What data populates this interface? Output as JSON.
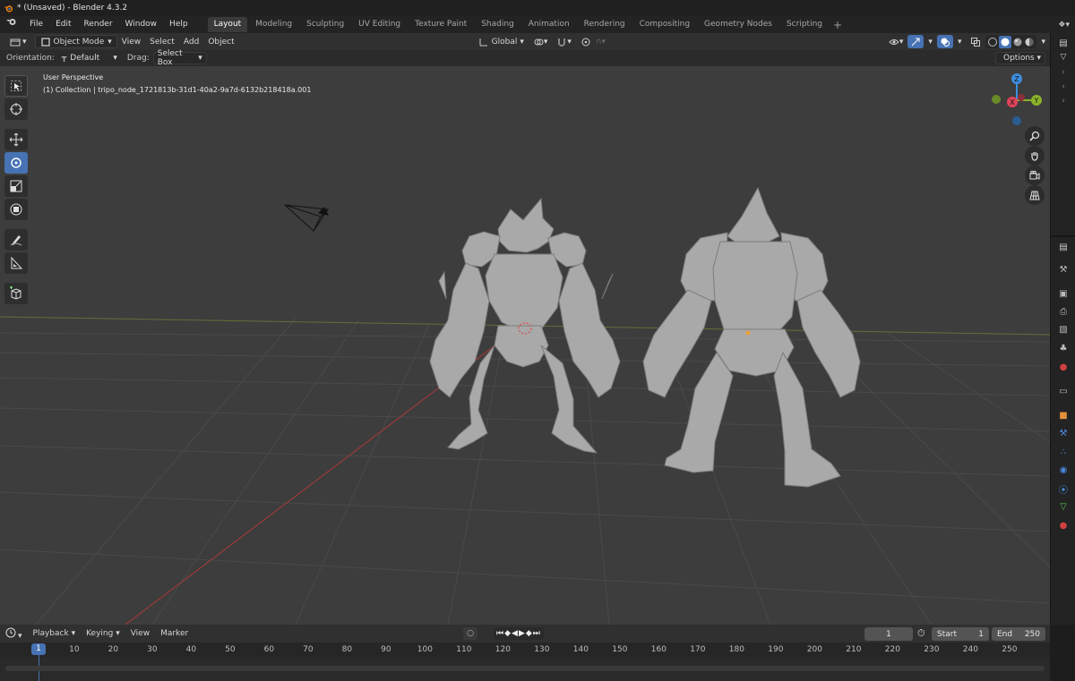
{
  "window": {
    "title": "* (Unsaved) - Blender 4.3.2"
  },
  "menu": [
    "File",
    "Edit",
    "Render",
    "Window",
    "Help"
  ],
  "workspaces": [
    "Layout",
    "Modeling",
    "Sculpting",
    "UV Editing",
    "Texture Paint",
    "Shading",
    "Animation",
    "Rendering",
    "Compositing",
    "Geometry Nodes",
    "Scripting"
  ],
  "active_workspace": "Layout",
  "viewport_header": {
    "mode": "Object Mode",
    "menus": [
      "View",
      "Select",
      "Add",
      "Object"
    ],
    "transform_orientation": "Global"
  },
  "tool_settings": {
    "orientation_label": "Orientation:",
    "orientation_value": "Default",
    "drag_label": "Drag:",
    "drag_value": "Select Box",
    "options_label": "Options"
  },
  "viewport": {
    "perspective_text": "User Perspective",
    "collection_text": "(1) Collection | tripo_node_1721813b-31d1-40a2-9a7d-6132b218418a.001",
    "background_color": "#3d3d3d"
  },
  "gizmo": {
    "z_label": "Z",
    "y_label": "Y",
    "x_label": "X"
  },
  "timeline": {
    "menus": [
      "Playback",
      "Keying",
      "View",
      "Marker"
    ],
    "current_frame": "1",
    "start_label": "Start",
    "start_value": "1",
    "end_label": "End",
    "end_value": "250",
    "ruler_labels": [
      "1",
      "10",
      "20",
      "30",
      "40",
      "50",
      "60",
      "70",
      "80",
      "90",
      "100",
      "110",
      "120",
      "130",
      "140",
      "150",
      "160",
      "170",
      "180",
      "190",
      "200",
      "210",
      "220",
      "230",
      "240",
      "250"
    ]
  },
  "colors": {
    "accent": "#4772b3",
    "x_axis": "#e0435a",
    "y_axis": "#8bb32a",
    "z_axis": "#3d8ee0"
  }
}
